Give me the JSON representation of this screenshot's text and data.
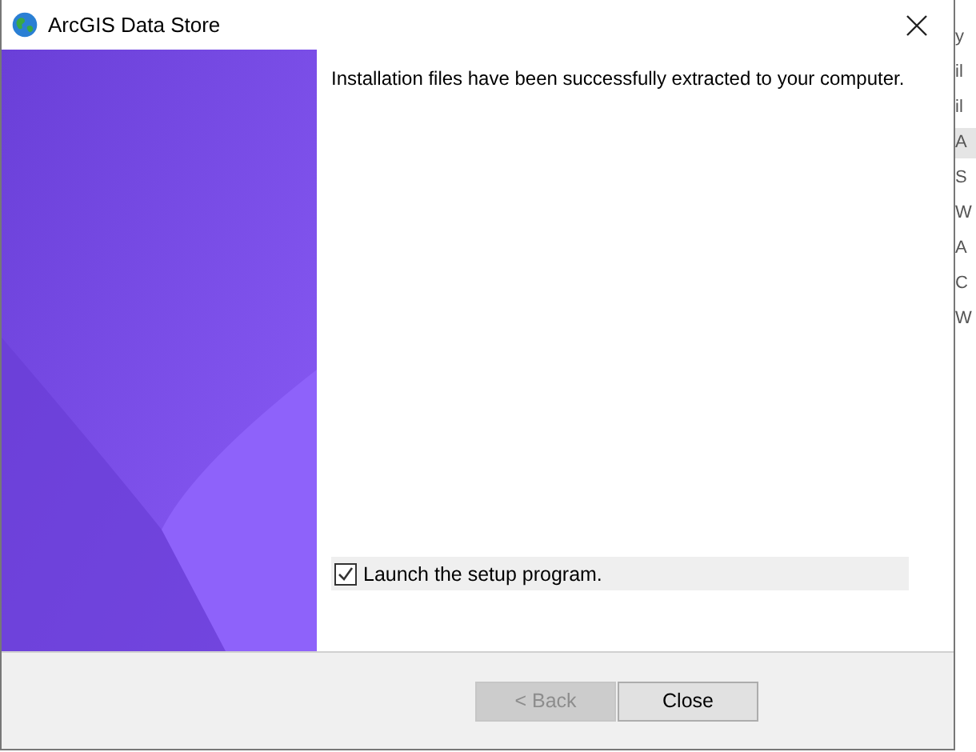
{
  "window": {
    "title": "ArcGIS Data Store"
  },
  "message": "Installation files have been successfully extracted to your computer.",
  "launch_option": {
    "label": "Launch the setup program.",
    "checked": true
  },
  "buttons": [
    {
      "label": "< Back",
      "disabled": true
    },
    {
      "label": "Close",
      "disabled": false
    }
  ],
  "background_window": {
    "fragments": [
      {
        "text": "y",
        "selected": false
      },
      {
        "text": "il",
        "selected": false
      },
      {
        "text": "il",
        "selected": false
      },
      {
        "text": "A",
        "selected": true
      },
      {
        "text": "S",
        "selected": false
      },
      {
        "text": "W",
        "selected": false
      },
      {
        "text": "A",
        "selected": false
      },
      {
        "text": "C",
        "selected": false
      },
      {
        "text": "W",
        "selected": false
      }
    ]
  }
}
